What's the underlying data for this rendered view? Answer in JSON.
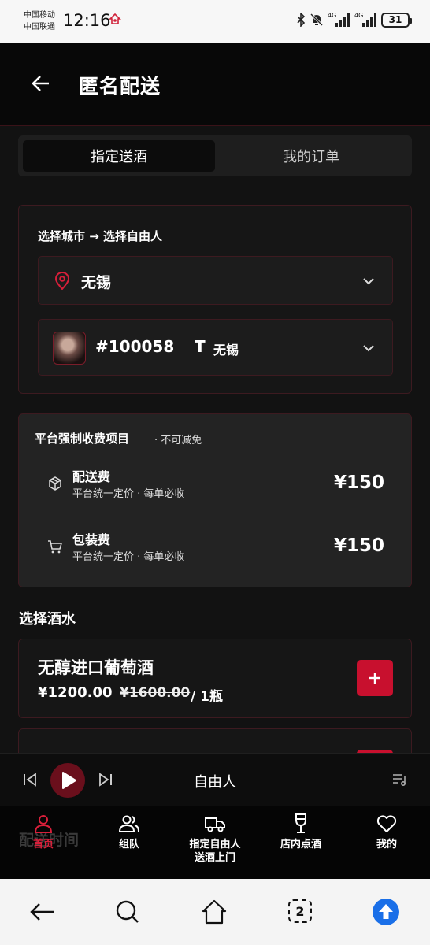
{
  "status_bar": {
    "carrier_1": "中国移动",
    "carrier_2": "中国联通",
    "time": "12:16",
    "network_1": "4G",
    "network_2": "4G",
    "battery": "31"
  },
  "header": {
    "title": "匿名配送"
  },
  "tabs": [
    {
      "label": "指定送酒",
      "active": true
    },
    {
      "label": "我的订单",
      "active": false
    }
  ],
  "selector": {
    "title": "选择城市 → 选择自由人",
    "city": "无锡",
    "person_id": "#100058",
    "person_tag": "T",
    "person_city": "无锡"
  },
  "fees": {
    "title": "平台强制收费项目",
    "note": "· 不可减免",
    "items": [
      {
        "name": "配送费",
        "sub": "平台统一定价 · 每单必收",
        "price": "¥150",
        "icon": "box-icon"
      },
      {
        "name": "包装费",
        "sub": "平台统一定价 · 每单必收",
        "price": "¥150",
        "icon": "cart-icon"
      }
    ]
  },
  "drinks": {
    "section_title": "选择酒水",
    "items": [
      {
        "name": "无醇进口葡萄酒",
        "price": "¥1200.00",
        "original_price": "¥1600.00",
        "unit": "/ 1瓶"
      }
    ]
  },
  "player": {
    "title": "自由人"
  },
  "background": {
    "delivery_time": "配送时间"
  },
  "nav": [
    {
      "label": "首页",
      "icon": "user-icon",
      "active": true
    },
    {
      "label": "组队",
      "icon": "group-icon",
      "active": false
    },
    {
      "label": "指定自由人\n送酒上门",
      "icon": "truck-icon",
      "active": false
    },
    {
      "label": "店内点酒",
      "icon": "wine-glass-icon",
      "active": false
    },
    {
      "label": "我的",
      "icon": "heart-icon",
      "active": false
    }
  ],
  "system_nav": {
    "tab_count": "2"
  },
  "colors": {
    "accent": "#c8102e",
    "card_border": "#3d1a20"
  }
}
